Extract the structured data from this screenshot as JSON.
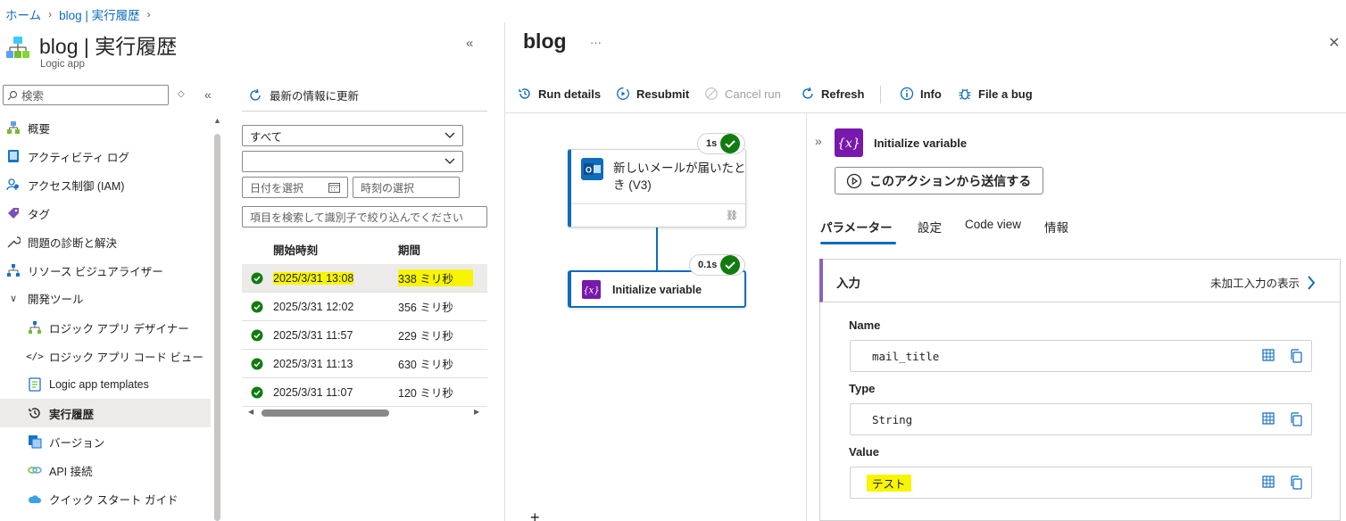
{
  "breadcrumb": {
    "home": "ホーム",
    "current": "blog | 実行履歴"
  },
  "header": {
    "title": "blog | 実行履歴",
    "subtitle": "Logic app"
  },
  "search": {
    "placeholder": "検索"
  },
  "nav": {
    "overview": "概要",
    "activity_log": "アクティビティ ログ",
    "iam": "アクセス制御 (IAM)",
    "tags": "タグ",
    "diagnose": "問題の診断と解決",
    "visualizer": "リソース ビジュアライザー",
    "dev_tools": "開発ツール",
    "designer": "ロジック アプリ デザイナー",
    "code_view": "ロジック アプリ コード ビュー",
    "templates": "Logic app templates",
    "run_history": "実行履歴",
    "versions": "バージョン",
    "api_connections": "API 接続",
    "quickstart": "クイック スタート ガイド"
  },
  "runs": {
    "refresh_label": "最新の情報に更新",
    "status_filter": "すべて",
    "second_filter": "",
    "date_placeholder": "日付を選択",
    "time_placeholder": "時刻の選択",
    "search_placeholder": "項目を検索して識別子で絞り込んでください",
    "col_start": "開始時刻",
    "col_duration": "期間",
    "rows": [
      {
        "start": "2025/3/31 13:08",
        "duration": "338 ミリ秒"
      },
      {
        "start": "2025/3/31 12:02",
        "duration": "356 ミリ秒"
      },
      {
        "start": "2025/3/31 11:57",
        "duration": "229 ミリ秒"
      },
      {
        "start": "2025/3/31 11:13",
        "duration": "630 ミリ秒"
      },
      {
        "start": "2025/3/31 11:07",
        "duration": "120 ミリ秒"
      }
    ]
  },
  "blade": {
    "title": "blog",
    "toolbar": {
      "run_details": "Run details",
      "resubmit": "Resubmit",
      "cancel_run": "Cancel run",
      "refresh": "Refresh",
      "info": "Info",
      "file_bug": "File a bug"
    }
  },
  "canvas": {
    "trigger": {
      "title": "新しいメールが届いたとき (V3)",
      "duration": "1s"
    },
    "action": {
      "title": "Initialize variable",
      "duration": "0.1s"
    },
    "add": "+"
  },
  "details": {
    "title": "Initialize variable",
    "send_button": "このアクションから送信する",
    "tabs": [
      "パラメーター",
      "設定",
      "Code view",
      "情報"
    ],
    "inputs_label": "入力",
    "raw_inputs_link": "未加工入力の表示",
    "fields": [
      {
        "label": "Name",
        "value": "mail_title"
      },
      {
        "label": "Type",
        "value": "String"
      },
      {
        "label": "Value",
        "value": "テスト"
      }
    ]
  },
  "colors": {
    "accent": "#0f6cbd",
    "success": "#107c10",
    "variable": "#7719aa",
    "highlight": "#f7f500"
  }
}
